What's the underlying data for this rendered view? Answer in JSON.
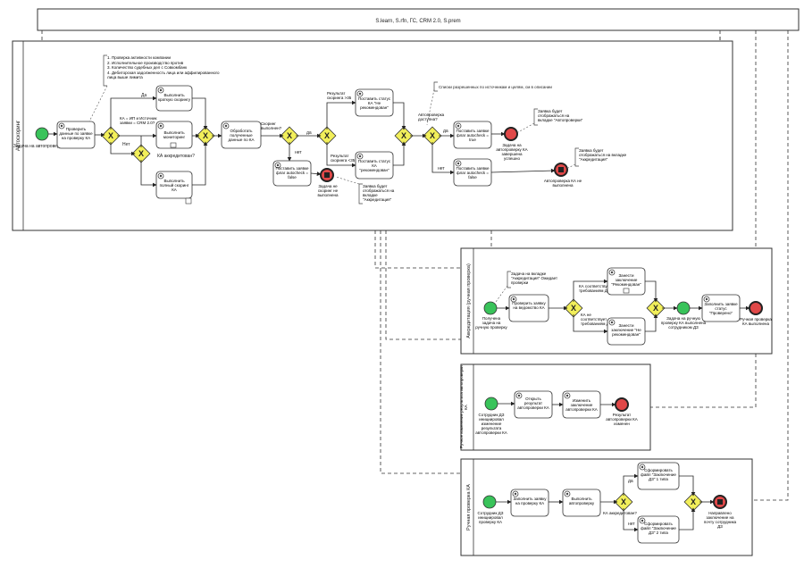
{
  "top_pool": {
    "label": "S.learn, S.rfn, ГС, CRM 2.0, S.prem"
  },
  "pools": {
    "auto": {
      "label": "Автоскоринг"
    },
    "accred": {
      "label": "Аккредитация (ручная проверка)"
    },
    "manual_change": {
      "label": "Ручное изменение результата автопроверки КА"
    },
    "manual_check": {
      "label": "Ручная проверка КА"
    }
  },
  "auto": {
    "start": "Задача на автопроверку КА",
    "check_task": "Проверить данные по заявке на проверку КА",
    "note_list": [
      "1. Проверка активности компании",
      "2. Исполнительное производство против",
      "3. Количество судебных дел с Совкомбанк",
      "4. Дебиторская задолженность лица или аффилированного лица выше лимита"
    ],
    "gw1_label": "КА = ИП и Источник заявки = CRM 2.0?",
    "yes": "Да",
    "no": "Нет",
    "short_check": "Выполнить краткую скорингу",
    "monitoring": "Выполнить мониторинг",
    "accredited_q": "КА аккредитован?",
    "full_check": "Выполнить полный скоринг КА",
    "process": "Обработать полученные данные по КА",
    "scoring_done": "Скоринг выполнен?",
    "yes2": "да",
    "no2": "нет",
    "set_flag_false": "Поставить заявке флаг autocheck = false",
    "end_no_scoring": "Задача не скоринг не выполнена",
    "note_accred1": "Заявка будет отображаться на вкладке \"Аккредитация\"",
    "result_gt": "Результат скоринга >35",
    "result_lt": "Результат скоринга <35",
    "set_not_recommended": "Поставить статус КА \"Не рекомендован\"",
    "set_recommended": "Поставить статус КА \"рекомендован\"",
    "note_lists": "Списки разрешенных по источникам и целям, см в описании",
    "autocheck_q": "Автопроверка доступна?",
    "set_flag_true": "Поставить заявке флаг autocheck = true",
    "set_flag_false2": "Поставить заявке флаг autocheck = false",
    "end_auto_done": "Задача на автопроверку КА завершена успешно",
    "note_autocheck": "Заявка будет отображаться на вкладке \"Автопроверки\"",
    "end_not_done": "Автопроверка КА не выполнена",
    "note_accred2": "Заявка будет отображаться на вкладке \"Аккредитация\""
  },
  "accred": {
    "start": "Получена задача на ручную проверку КА",
    "note": "Задача на вкладке \"Аккредитация\" Ожидает проверки",
    "check": "Проверить заявку на ведомство КА",
    "matches_q": "КА соответствует требованиям ДЗ?",
    "not_matches": "КА не соответствует требованиям ДЗ?",
    "conclusion_rec": "Занести заключение \"Рекомендован\"",
    "conclusion_notrec": "Занести заключение \"Не рекомендован\"",
    "end_mid": "Задача на ручную проверку КА выполнена сотрудником ДЗ",
    "set_checked": "Заполнить заявке статус \"Проверено\"",
    "end": "Ручная проверка КА выполнена"
  },
  "manual_change": {
    "start": "Сотрудник ДЗ инициировал изменение результата автопроверки КА",
    "open": "Открыть результат автопроверки КА",
    "change": "Изменить заключение автопроверки КА",
    "end": "Результат автопроверки КА изменен"
  },
  "manual_check": {
    "start": "Сотрудник ДЗ инициировал проверку КА",
    "fill": "Заполнить заявку на проверку КА",
    "run": "Выполнить автопроверку",
    "accredited_q": "КА аккредитован?",
    "yes": "да",
    "no": "нет",
    "form1": "Сформировать файл \"Заключение ДЗ\" 1 типа",
    "form2": "Сформировать файл \"Заключение ДЗ\" 2 типа",
    "end": "Направлено заключение на почту сотрудника ДЗ"
  },
  "colors": {
    "gateway": "#f2ef5a",
    "start": "#39c35a",
    "end": "#e04848"
  }
}
